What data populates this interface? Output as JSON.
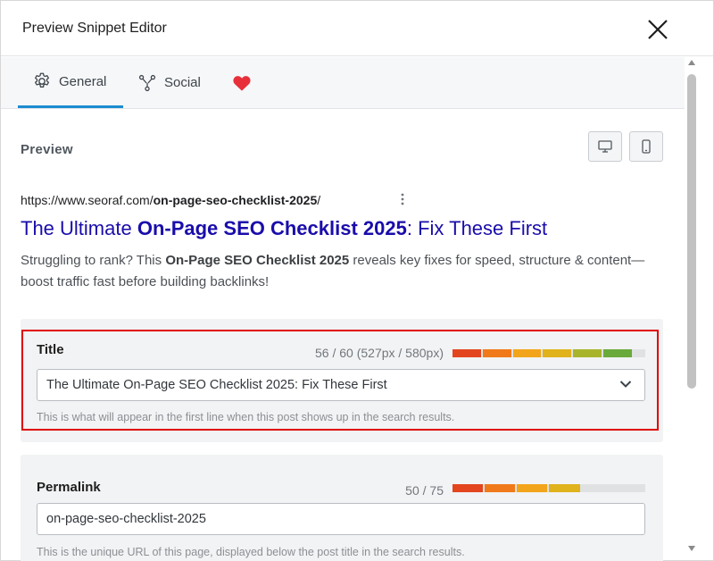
{
  "dialog": {
    "title": "Preview Snippet Editor"
  },
  "tabs": [
    {
      "label": "General",
      "icon": "gear-icon",
      "active": true
    },
    {
      "label": "Social",
      "icon": "share-nodes-icon",
      "active": false
    },
    {
      "label": "",
      "icon": "heart-icon",
      "active": false
    }
  ],
  "preview": {
    "label": "Preview",
    "devices": [
      "desktop-icon",
      "mobile-icon"
    ],
    "url_prefix": "https://www.seoraf.com/",
    "url_slug": "on-page-seo-checklist-2025",
    "url_suffix": "/",
    "title_pre": "The Ultimate ",
    "title_bold": "On-Page SEO Checklist 2025",
    "title_post": ": Fix These First",
    "desc_pre": "Struggling to rank? This ",
    "desc_bold": "On-Page SEO Checklist 2025",
    "desc_post": " reveals key fixes for speed, structure & content—boost traffic fast before building backlinks!"
  },
  "title_field": {
    "label": "Title",
    "count": "56 / 60 (527px / 580px)",
    "value": "The Ultimate On-Page SEO Checklist 2025: Fix These First",
    "help": "This is what will appear in the first line when this post shows up in the search results.",
    "meter_fill": 0.93,
    "meter_colors": [
      "#e3461f",
      "#f07a1a",
      "#f2a51a",
      "#e0b21c",
      "#a8b52b",
      "#6aaa3b"
    ]
  },
  "permalink_field": {
    "label": "Permalink",
    "count": "50 / 75",
    "value": "on-page-seo-checklist-2025",
    "help": "This is the unique URL of this page, displayed below the post title in the search results.",
    "meter_fill": 0.66,
    "meter_colors": [
      "#e3461f",
      "#f07a1a",
      "#f2a51a",
      "#e0b21c"
    ]
  },
  "colors": {
    "accent": "#1b8cd0",
    "link": "#1a0dab",
    "highlight": "#e00000",
    "heart": "#e8303a"
  }
}
